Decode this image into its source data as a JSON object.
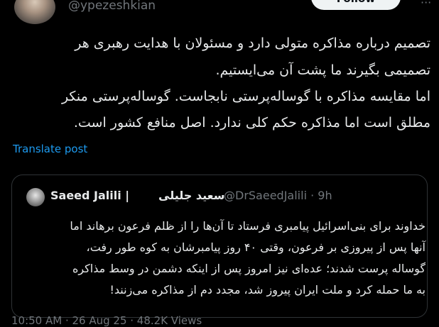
{
  "author": {
    "handle": "@ypezeshkian",
    "follow_label": "Follow",
    "more_label": "···"
  },
  "tweet": {
    "lines": [
      "تصمیم درباره مذاکره متولی دارد و مسئولان با هدایت رهبری هر",
      "تصمیمی بگیرند ما پشت آن می‌ایستیم.",
      "اما مقایسه مذاکره با گوساله‌پرستی نابجاست. گوساله‌پرستی منکر",
      "مطلق است اما مذاکره حکم کلی ندارد. اصل منافع کشور است."
    ],
    "translate_label": "Translate post"
  },
  "quote": {
    "name": "Saeed Jalili |",
    "name_fa": "سعید جلیلی",
    "handle_time": "@DrSaeedJalili · 9h",
    "lines": [
      "خداوند برای بنی‌اسرائیل پیامبری فرستاد تا آن‌ها را از ظلم فرعون برهاند اما",
      "آنها پس از پیروزی بر فرعون، وقتی ۴۰ روز پیامبرشان به کوه طور رفت،",
      "گوساله پرست شدند؛ عده‌ای نیز امروز پس از اینکه دشمن در وسط مذاکره",
      "به ما حمله کرد و ملت ایران پیروز شد، مجدد دم از مذاکره می‌زنند!"
    ]
  },
  "meta": {
    "text": "10:50 AM · 26 Aug 25 · 48.2K Views"
  }
}
